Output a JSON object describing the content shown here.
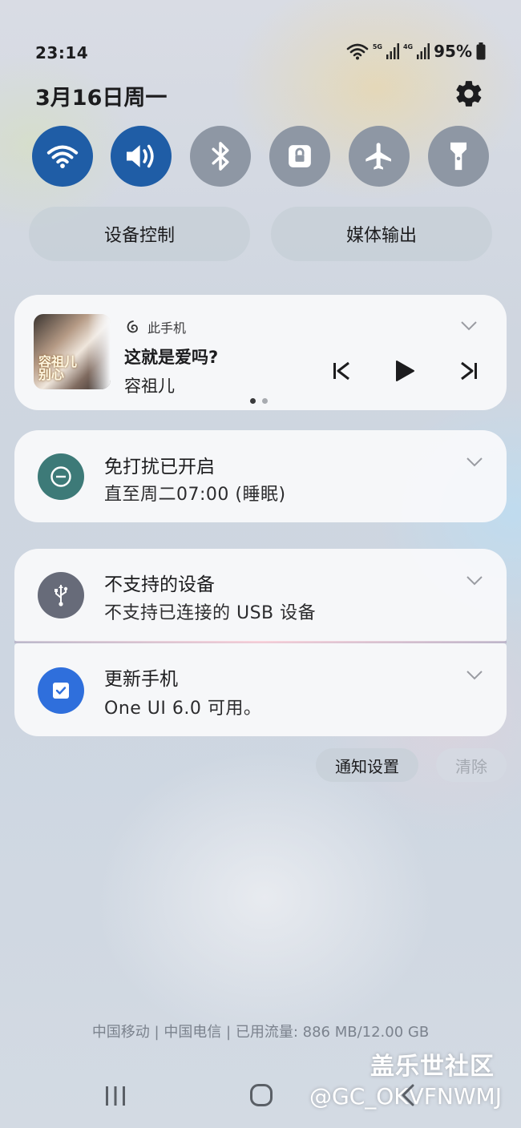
{
  "status_bar": {
    "time": "23:14",
    "network_1": "5G",
    "network_2": "4G",
    "battery": "95%"
  },
  "header": {
    "date": "3月16日周一"
  },
  "quick_settings": [
    {
      "name": "wifi-icon",
      "state": "on"
    },
    {
      "name": "sound-icon",
      "state": "on"
    },
    {
      "name": "bluetooth-icon",
      "state": "off"
    },
    {
      "name": "rotation-lock-icon",
      "state": "off"
    },
    {
      "name": "airplane-icon",
      "state": "off"
    },
    {
      "name": "flashlight-icon",
      "state": "off"
    }
  ],
  "pills": {
    "device_control": "设备控制",
    "media_output": "媒体输出"
  },
  "media": {
    "source": "此手机",
    "song": "这就是爱吗?",
    "artist": "容祖儿",
    "album_art_text": "容祖儿 别心",
    "page_indicator": {
      "count": 2,
      "active": 0
    }
  },
  "notifications": [
    {
      "title": "免打扰已开启",
      "text": "直至周二07:00 (睡眠)",
      "icon": "do-not-disturb-icon"
    },
    {
      "title": "不支持的设备",
      "text": "不支持已连接的 USB 设备",
      "icon": "usb-icon"
    },
    {
      "title": "更新手机",
      "text": "One UI 6.0 可用。",
      "icon": "update-icon"
    }
  ],
  "actions": {
    "notification_settings": "通知设置",
    "clear": "清除"
  },
  "footer": {
    "carrier_info": "中国移动 | 中国电信 | 已用流量: 886 MB/12.00 GB"
  },
  "watermark": {
    "logo": "盖乐世社区",
    "user": "@GC_OKVFNWMJ"
  },
  "colors": {
    "accent_on": "#1f5da6",
    "toggle_off": "#8e97a4",
    "dnd_icon": "#3d7a78",
    "usb_icon": "#676b79",
    "update_icon": "#2f6fdc"
  }
}
